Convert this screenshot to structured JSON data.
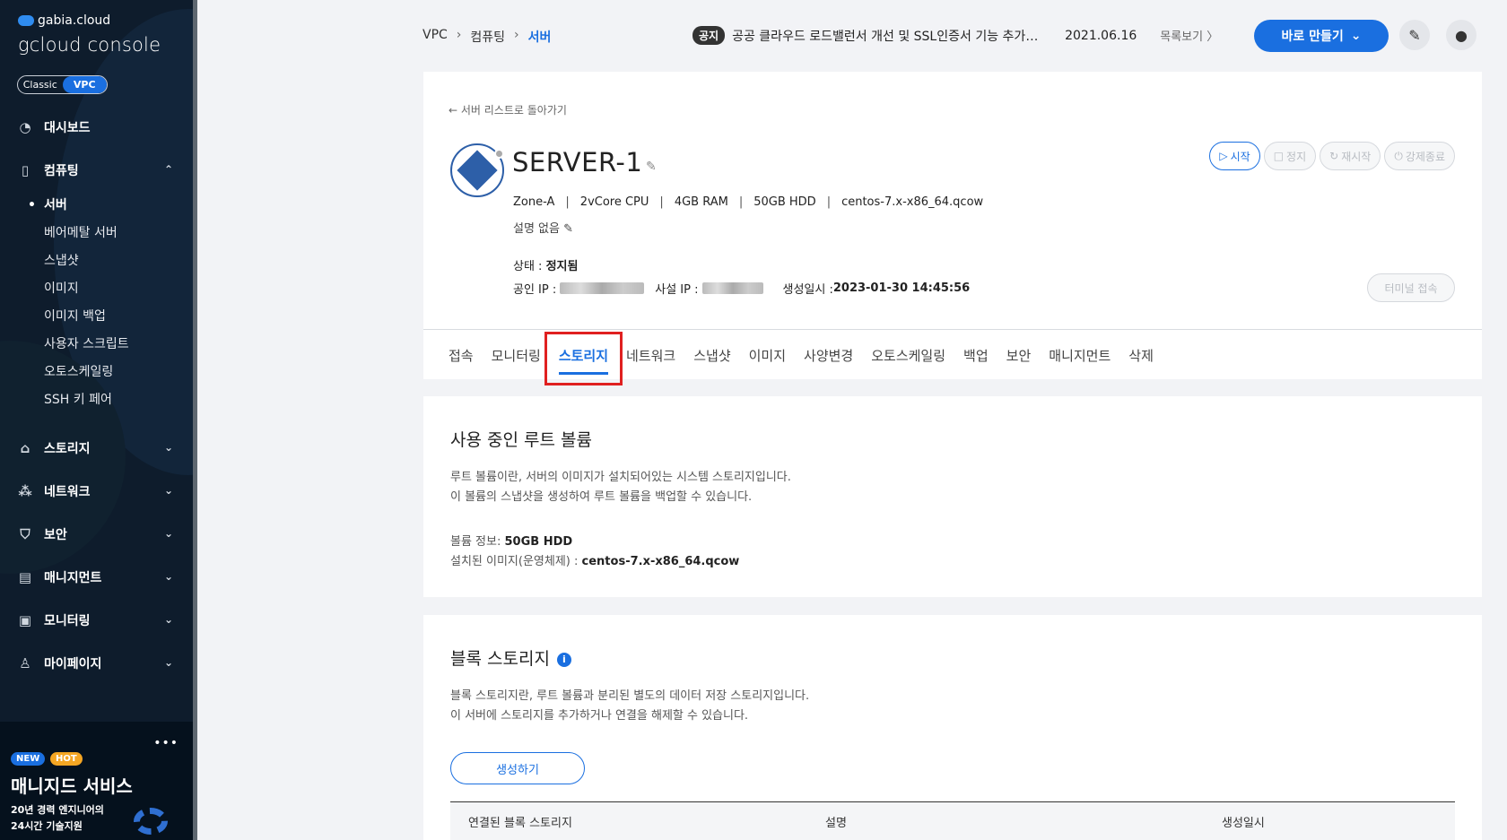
{
  "sidebar": {
    "brand_top": "gabia.cloud",
    "brand_main": "gcloud console",
    "toggle": [
      "Classic",
      "VPC"
    ],
    "items": [
      {
        "label": "대시보드",
        "icon": "dashboard-icon"
      },
      {
        "label": "컴퓨팅",
        "icon": "chip-icon",
        "chevron": "⌃"
      },
      {
        "label": "스토리지",
        "icon": "storage-icon",
        "chevron": "⌄"
      },
      {
        "label": "네트워크",
        "icon": "network-icon",
        "chevron": "⌄"
      },
      {
        "label": "보안",
        "icon": "shield-icon",
        "chevron": "⌄"
      },
      {
        "label": "매니지먼트",
        "icon": "management-icon",
        "chevron": "⌄"
      },
      {
        "label": "모니터링",
        "icon": "monitor-icon",
        "chevron": "⌄"
      },
      {
        "label": "마이페이지",
        "icon": "user-icon",
        "chevron": "⌄"
      }
    ],
    "sub_items": [
      "서버",
      "베어메탈 서버",
      "스냅샷",
      "이미지",
      "이미지 백업",
      "사용자 스크립트",
      "오토스케일링",
      "SSH 키 페어"
    ],
    "promo": {
      "dots": "•••",
      "new": "NEW",
      "hot": "HOT",
      "title": "매니지드 서비스",
      "desc1": "20년 경력 엔지니어의",
      "desc2": "24시간 기술지원"
    }
  },
  "header": {
    "breadcrumb": [
      "VPC",
      "컴퓨팅",
      "서버"
    ],
    "notice_tag": "공지",
    "notice_text": "공공 클라우드 로드밸런서 개선 및 SSL인증서 기능 추가 안내",
    "notice_date": "2021.06.16",
    "notice_more": "목록보기 〉",
    "make_button": "바로 만들기",
    "make_chevron": "⌄"
  },
  "server": {
    "back_link": "← 서버 리스트로 돌아가기",
    "name": "SERVER-1",
    "specs": [
      "Zone-A",
      "2vCore CPU",
      "4GB RAM",
      "50GB HDD",
      "centos-7.x-x86_64.qcow"
    ],
    "description": "설명 없음",
    "state_label": "상태 : ",
    "state_value": "정지됨",
    "public_ip_label": "공인 IP :",
    "private_ip_label": "사설 IP :",
    "created_label": "생성일시 : ",
    "created_value": "2023-01-30 14:45:56",
    "actions": [
      {
        "label": "시작",
        "icon": "▷"
      },
      {
        "label": "정지",
        "icon": "□"
      },
      {
        "label": "재시작",
        "icon": "↻"
      },
      {
        "label": "강제종료",
        "icon": "⏻"
      }
    ],
    "terminal_button": "터미널 접속"
  },
  "tabs": [
    "접속",
    "모니터링",
    "스토리지",
    "네트워크",
    "스냅샷",
    "이미지",
    "사양변경",
    "오토스케일링",
    "백업",
    "보안",
    "매니지먼트",
    "삭제"
  ],
  "root_volume": {
    "title": "사용 중인 루트 볼륨",
    "desc1": "루트 볼륨이란, 서버의 이미지가 설치되어있는 시스템 스토리지입니다.",
    "desc2": "이 볼륨의 스냅샷을 생성하여 루트 볼륨을 백업할 수 있습니다.",
    "info_label": "볼륨 정보: ",
    "info_value": "50GB HDD",
    "image_label": "설치된 이미지(운영체제) : ",
    "image_value": "centos-7.x-x86_64.qcow"
  },
  "block_storage": {
    "title": "블록 스토리지",
    "desc1": "블록 스토리지란, 루트 볼륨과 분리된 별도의 데이터 저장 스토리지입니다.",
    "desc2": "이 서버에 스토리지를 추가하거나 연결을 해제할 수 있습니다.",
    "create_button": "생성하기",
    "columns": [
      "연결된 블록 스토리지",
      "설명",
      "생성일시"
    ]
  },
  "colors": {
    "accent": "#1a6fe0",
    "sidebar_bg": "#0e1c2c",
    "highlight": "#e02020"
  }
}
